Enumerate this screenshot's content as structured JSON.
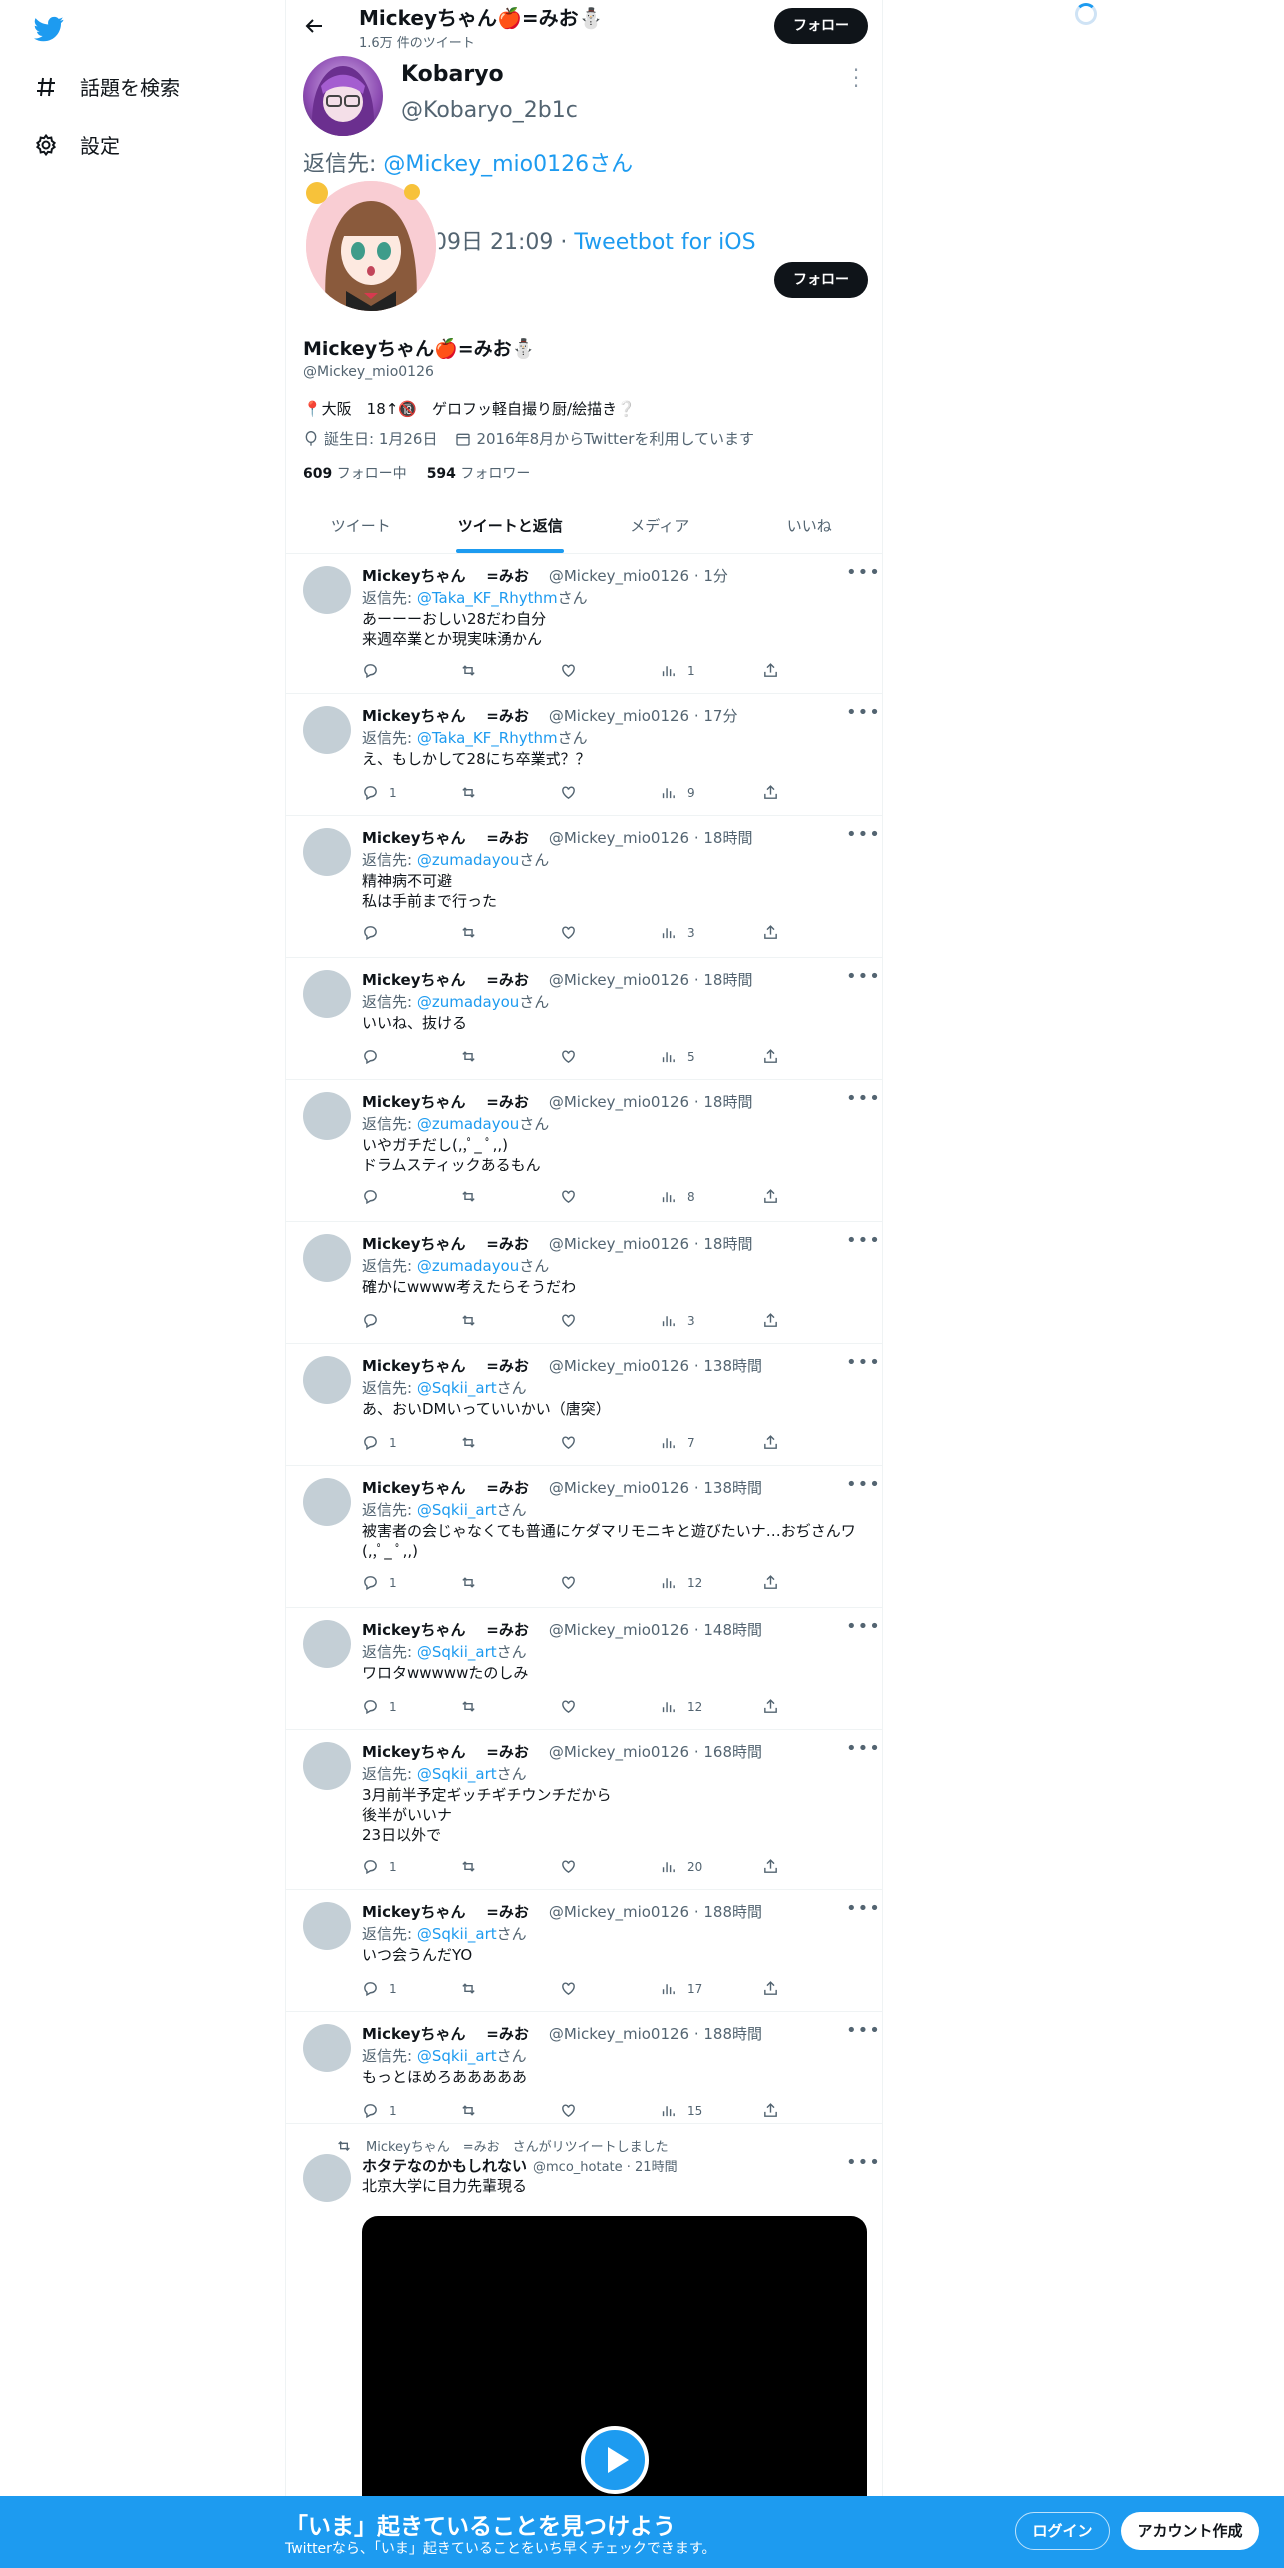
{
  "left_nav": {
    "items": [
      {
        "label": "話題を検索",
        "icon": "hashtag-icon"
      },
      {
        "label": "設定",
        "icon": "gear-icon"
      }
    ]
  },
  "header": {
    "title": "Mickeyちゃん🍎=みお⛄",
    "subtitle": "1.6万 件のツイート",
    "follow": "フォロー"
  },
  "quoted": {
    "name": "Kobaryo",
    "handle": "@Kobaryo_2b1c",
    "reply_prefix": "返信先: ",
    "reply_to": "@Mickey_mio0126さん",
    "date": "09日 21:09 · ",
    "client": "Tweetbot for iOS"
  },
  "profile": {
    "follow": "フォロー",
    "name": "Mickeyちゃん🍎=みお⛄",
    "handle": "@Mickey_mio0126",
    "bio": "📍大阪　18↑🔞　ゲロフッ軽自撮り厨/絵描き❔",
    "birthday": "誕生日: 1月26日",
    "joined": "2016年8月からTwitterを利用しています",
    "following_count": "609",
    "following_label": "フォロー中",
    "followers_count": "594",
    "followers_label": "フォロワー"
  },
  "tabs": [
    "ツイート",
    "ツイートと返信",
    "メディア",
    "いいね"
  ],
  "tweets": [
    {
      "name": "Mickeyちゃん",
      "name2": "=みお",
      "handle": "@Mickey_mio0126 · 1分",
      "reply": "@Taka_KF_Rhythm",
      "suffix": "さん",
      "text": "あーーーおしい28だわ自分\n来週卒業とか現実味湧かん",
      "replies": "",
      "views": "1"
    },
    {
      "name": "Mickeyちゃん",
      "name2": "=みお",
      "handle": "@Mickey_mio0126 · 17分",
      "reply": "@Taka_KF_Rhythm",
      "suffix": "さん",
      "text": "え、もしかして28にち卒業式？？",
      "replies": "1",
      "views": "9"
    },
    {
      "name": "Mickeyちゃん",
      "name2": "=みお",
      "handle": "@Mickey_mio0126 · 18時間",
      "reply": "@zumadayou",
      "suffix": "さん",
      "text": "精神病不可避\n私は手前まで行った",
      "replies": "",
      "views": "3"
    },
    {
      "name": "Mickeyちゃん",
      "name2": "=みお",
      "handle": "@Mickey_mio0126 · 18時間",
      "reply": "@zumadayou",
      "suffix": "さん",
      "text": "いいね、抜ける",
      "replies": "",
      "views": "5"
    },
    {
      "name": "Mickeyちゃん",
      "name2": "=みお",
      "handle": "@Mickey_mio0126 · 18時間",
      "reply": "@zumadayou",
      "suffix": "さん",
      "text": "いやガチだし(,,ﾟ_ ﾟ,,)\nドラムスティックあるもん",
      "replies": "",
      "views": "8"
    },
    {
      "name": "Mickeyちゃん",
      "name2": "=みお",
      "handle": "@Mickey_mio0126 · 18時間",
      "reply": "@zumadayou",
      "suffix": "さん",
      "text": "確かにwwww考えたらそうだわ",
      "replies": "",
      "views": "3"
    },
    {
      "name": "Mickeyちゃん",
      "name2": "=みお",
      "handle": "@Mickey_mio0126 · 138時間",
      "reply": "@Sqkii_art",
      "suffix": "さん",
      "text": "あ、おいDMいっていいかい（唐突）",
      "replies": "1",
      "views": "7"
    },
    {
      "name": "Mickeyちゃん",
      "name2": "=みお",
      "handle": "@Mickey_mio0126 · 138時間",
      "reply": "@Sqkii_art",
      "suffix": "さん",
      "text": "被害者の会じゃなくても普通にケダマリモニキと遊びたいナ…おぢさんワ(,,ﾟ_ ﾟ,,)",
      "replies": "1",
      "views": "12"
    },
    {
      "name": "Mickeyちゃん",
      "name2": "=みお",
      "handle": "@Mickey_mio0126 · 148時間",
      "reply": "@Sqkii_art",
      "suffix": "さん",
      "text": "ワロタwwwwwたのしみ",
      "replies": "1",
      "views": "12"
    },
    {
      "name": "Mickeyちゃん",
      "name2": "=みお",
      "handle": "@Mickey_mio0126 · 168時間",
      "reply": "@Sqkii_art",
      "suffix": "さん",
      "text": "3月前半予定ギッチギチウンチだから\n後半がいいナ\n23日以外で",
      "replies": "1",
      "views": "20"
    },
    {
      "name": "Mickeyちゃん",
      "name2": "=みお",
      "handle": "@Mickey_mio0126 · 188時間",
      "reply": "@Sqkii_art",
      "suffix": "さん",
      "text": "いつ会うんだYO",
      "replies": "1",
      "views": "17"
    },
    {
      "name": "Mickeyちゃん",
      "name2": "=みお",
      "handle": "@Mickey_mio0126 · 188時間",
      "reply": "@Sqkii_art",
      "suffix": "さん",
      "text": "もっとほめろあああああ",
      "replies": "1",
      "views": "15"
    }
  ],
  "retweet": {
    "rt_label": "Mickeyちゃん　=みお　さんがリツイートしました",
    "name": "ホタテなのかもしれない",
    "handle": "@mco_hotate · 21時間",
    "text": "北京大学に目力先輩現る"
  },
  "reply_prefix": "返信先: ",
  "bottom_bar": {
    "title": "「いま」起きていることを見つけよう",
    "subtitle": "Twitterなら、「いま」起きていることをいち早くチェックできます。",
    "login": "ログイン",
    "signup": "アカウント作成"
  },
  "colors": {
    "accent": "#1d9bf0",
    "text": "#0f1419",
    "muted": "#536471"
  }
}
